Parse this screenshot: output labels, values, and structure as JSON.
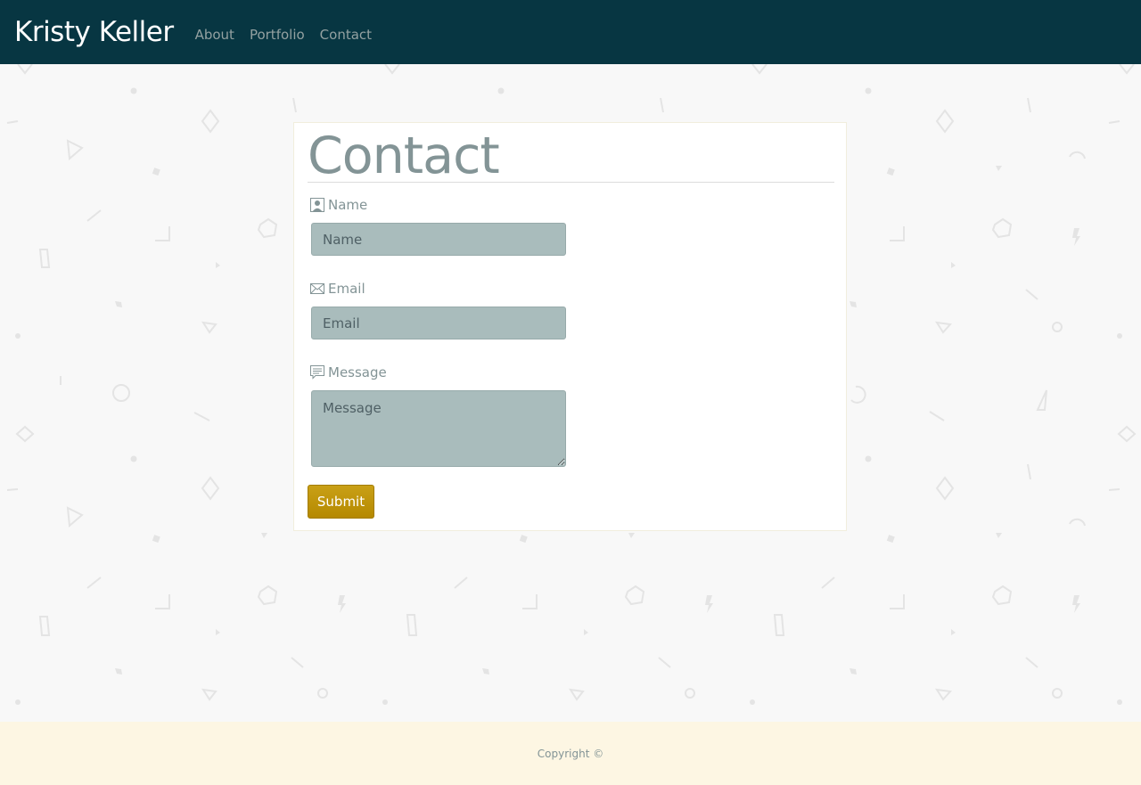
{
  "navbar": {
    "brand": "Kristy Keller",
    "links": [
      "About",
      "Portfolio",
      "Contact"
    ]
  },
  "main": {
    "title": "Contact",
    "form": {
      "name": {
        "label": "Name",
        "placeholder": "Name",
        "value": "",
        "icon": "user-icon"
      },
      "email": {
        "label": "Email",
        "placeholder": "Email",
        "value": "",
        "icon": "envelope-icon"
      },
      "message": {
        "label": "Message",
        "placeholder": "Message",
        "value": "",
        "icon": "chat-icon"
      },
      "submit_label": "Submit"
    }
  },
  "footer": {
    "copyright": "Copyright ©"
  },
  "colors": {
    "navbar_bg": "#073642",
    "accent": "#b58900",
    "field_bg": "#a9bcbc",
    "footer_bg": "#fdf6e3",
    "muted_text": "#839496"
  }
}
